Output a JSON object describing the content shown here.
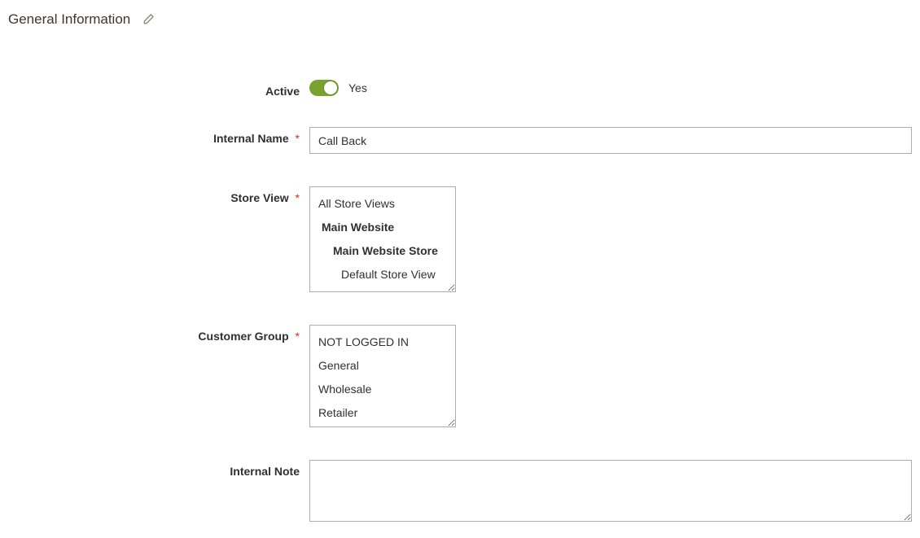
{
  "section": {
    "title": "General Information"
  },
  "fields": {
    "active": {
      "label": "Active",
      "value_text": "Yes",
      "on": true
    },
    "internal_name": {
      "label": "Internal Name",
      "value": "Call Back",
      "required": true
    },
    "store_view": {
      "label": "Store View",
      "required": true,
      "options": [
        {
          "label": "All Store Views",
          "level": 0
        },
        {
          "label": "Main Website",
          "level": 1
        },
        {
          "label": "Main Website Store",
          "level": 2
        },
        {
          "label": "Default Store View",
          "level": 3
        }
      ]
    },
    "customer_group": {
      "label": "Customer Group",
      "required": true,
      "options": [
        {
          "label": "NOT LOGGED IN"
        },
        {
          "label": "General"
        },
        {
          "label": "Wholesale"
        },
        {
          "label": "Retailer"
        }
      ]
    },
    "internal_note": {
      "label": "Internal Note",
      "value": ""
    }
  },
  "required_mark": "*"
}
